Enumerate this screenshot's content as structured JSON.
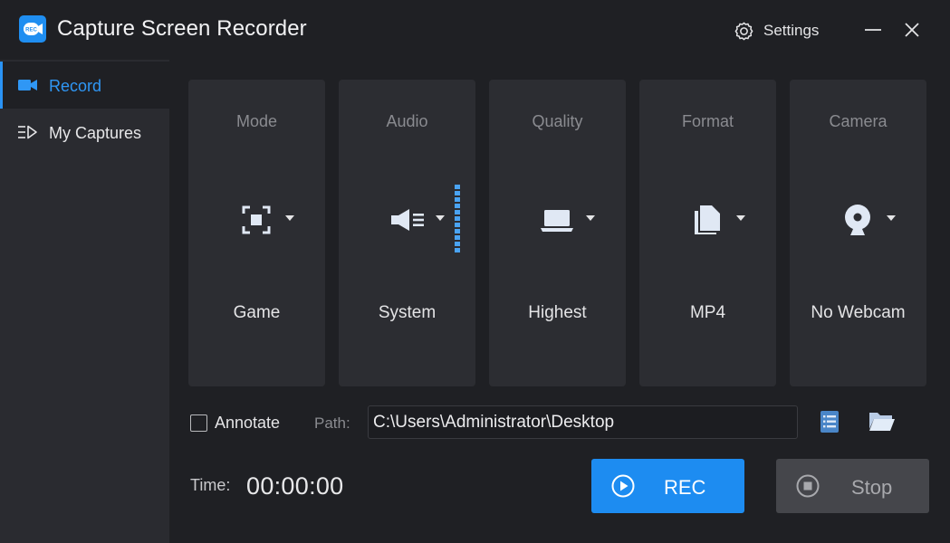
{
  "window": {
    "title": "Capture Screen Recorder",
    "settings_label": "Settings",
    "logo_icon": "rec-camera-logo",
    "minimize_icon": "minimize-icon",
    "close_icon": "close-icon"
  },
  "sidebar": {
    "items": [
      {
        "label": "Record",
        "icon": "video-camera-icon",
        "active": true
      },
      {
        "label": "My Captures",
        "icon": "list-play-icon",
        "active": false
      }
    ]
  },
  "cards": [
    {
      "title": "Mode",
      "value": "Game",
      "icon": "screen-region-icon"
    },
    {
      "title": "Audio",
      "value": "System",
      "icon": "speaker-icon"
    },
    {
      "title": "Quality",
      "value": "Highest",
      "icon": "laptop-icon"
    },
    {
      "title": "Format",
      "value": "MP4",
      "icon": "file-icon"
    },
    {
      "title": "Camera",
      "value": "No Webcam",
      "icon": "webcam-icon"
    }
  ],
  "options": {
    "annotate_label": "Annotate",
    "annotate_checked": false,
    "path_label": "Path:",
    "path_value": "C:\\Users\\Administrator\\Desktop"
  },
  "status": {
    "time_label": "Time:",
    "time_value": "00:00:00"
  },
  "actions": {
    "rec_label": "REC",
    "stop_label": "Stop"
  },
  "colors": {
    "accent": "#1d8cf1",
    "background": "#1f2024",
    "panel": "#2c2d32",
    "sidebar": "#2a2b30"
  }
}
